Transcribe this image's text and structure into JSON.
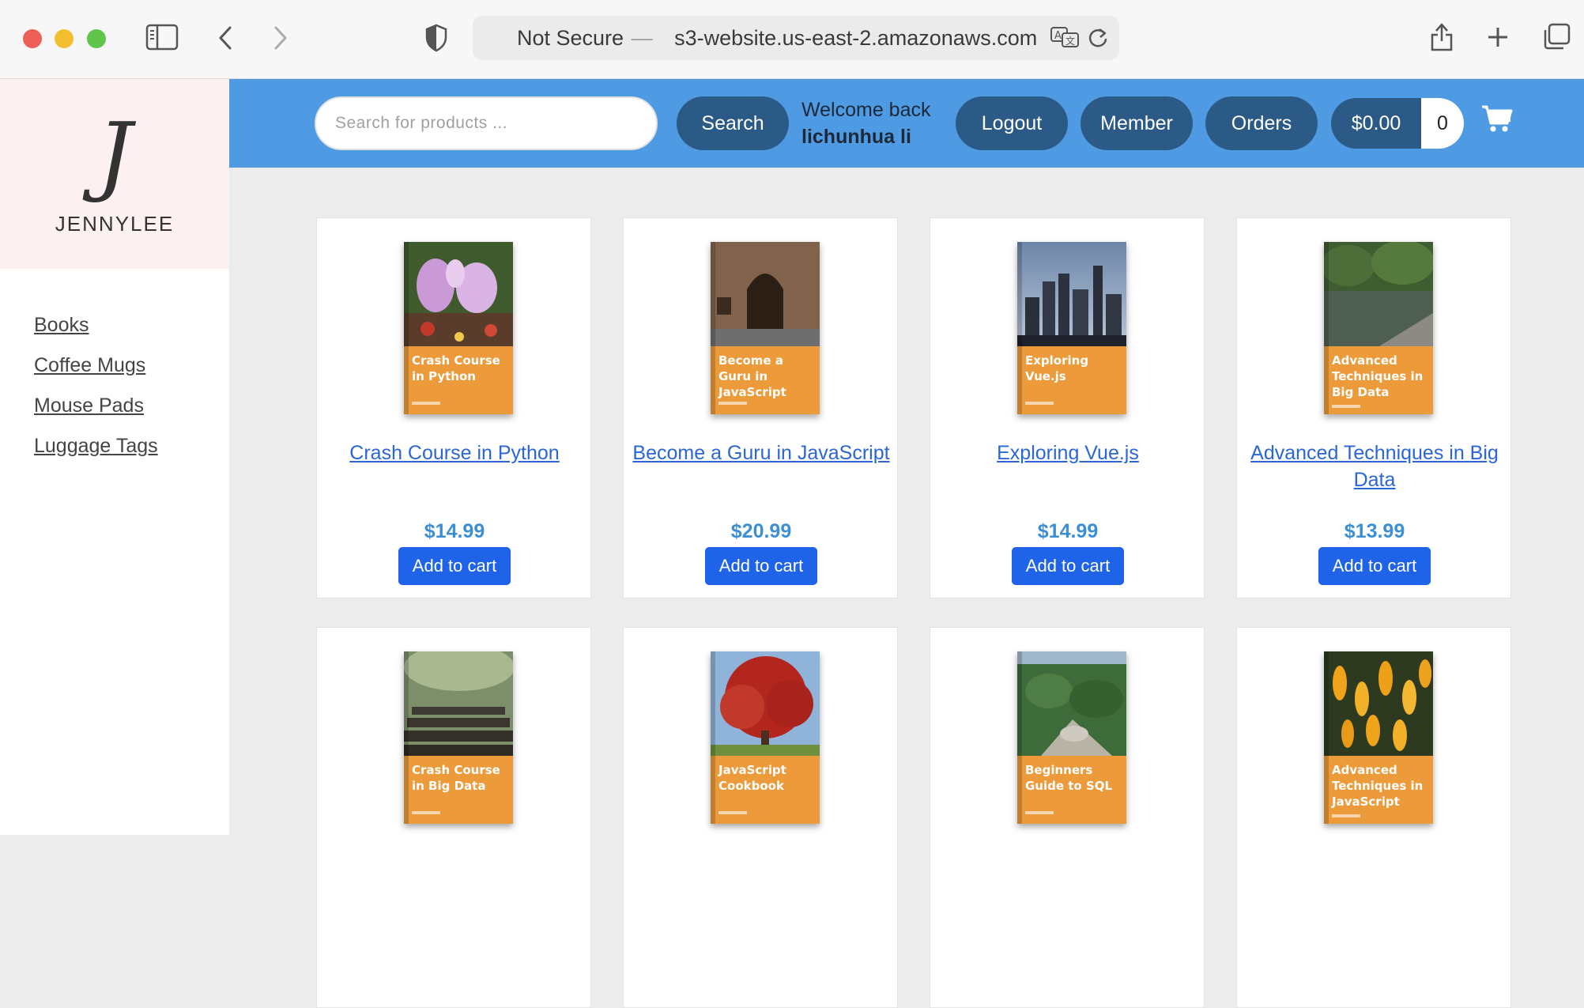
{
  "browser": {
    "security_label": "Not Secure",
    "separator": "—",
    "url": "s3-website.us-east-2.amazonaws.com"
  },
  "header": {
    "search_placeholder": "Search for products ...",
    "search_button": "Search",
    "welcome_text": "Welcome back",
    "username": "lichunhua li",
    "logout": "Logout",
    "member": "Member",
    "orders": "Orders",
    "cart_total": "$0.00",
    "cart_count": "0"
  },
  "brand": {
    "monogram": "J",
    "name": "JENNYLEE"
  },
  "sidebar": {
    "categories": [
      "Books",
      "Coffee Mugs",
      "Mouse Pads",
      "Luggage Tags"
    ]
  },
  "products": [
    {
      "title": "Crash Course in Python",
      "cover_title": "Crash Course in Python",
      "price": "$14.99",
      "add_label": "Add to cart",
      "photo": "orchid"
    },
    {
      "title": "Become a Guru in JavaScript",
      "cover_title": "Become a Guru in JavaScript",
      "price": "$20.99",
      "add_label": "Add to cart",
      "photo": "arch"
    },
    {
      "title": "Exploring Vue.js",
      "cover_title": "Exploring Vue.js",
      "price": "$14.99",
      "add_label": "Add to cart",
      "photo": "skyline"
    },
    {
      "title": "Advanced Techniques in Big Data",
      "cover_title": "Advanced Techniques in Big Data",
      "price": "$13.99",
      "add_label": "Add to cart",
      "photo": "river"
    },
    {
      "title": "",
      "cover_title": "Crash Course in Big Data",
      "price": "",
      "add_label": "",
      "photo": "steps"
    },
    {
      "title": "",
      "cover_title": "JavaScript Cookbook",
      "price": "",
      "add_label": "",
      "photo": "redtree"
    },
    {
      "title": "",
      "cover_title": "Beginners Guide to SQL",
      "price": "",
      "add_label": "",
      "photo": "aerial"
    },
    {
      "title": "",
      "cover_title": "Advanced Techniques in JavaScript",
      "price": "",
      "add_label": "",
      "photo": "flowers"
    }
  ],
  "colors": {
    "header_bg": "#4f9be3",
    "pill_bg": "#2c5a86",
    "link": "#2a66d6",
    "price": "#3d8fd4",
    "add_button": "#1f63e8",
    "cover_band": "#ec9a3a"
  },
  "icons": [
    "sidebar-toggle-icon",
    "back-icon",
    "forward-icon",
    "shield-icon",
    "translate-icon",
    "reload-icon",
    "share-icon",
    "new-tab-icon",
    "tabs-overview-icon",
    "cart-icon"
  ]
}
